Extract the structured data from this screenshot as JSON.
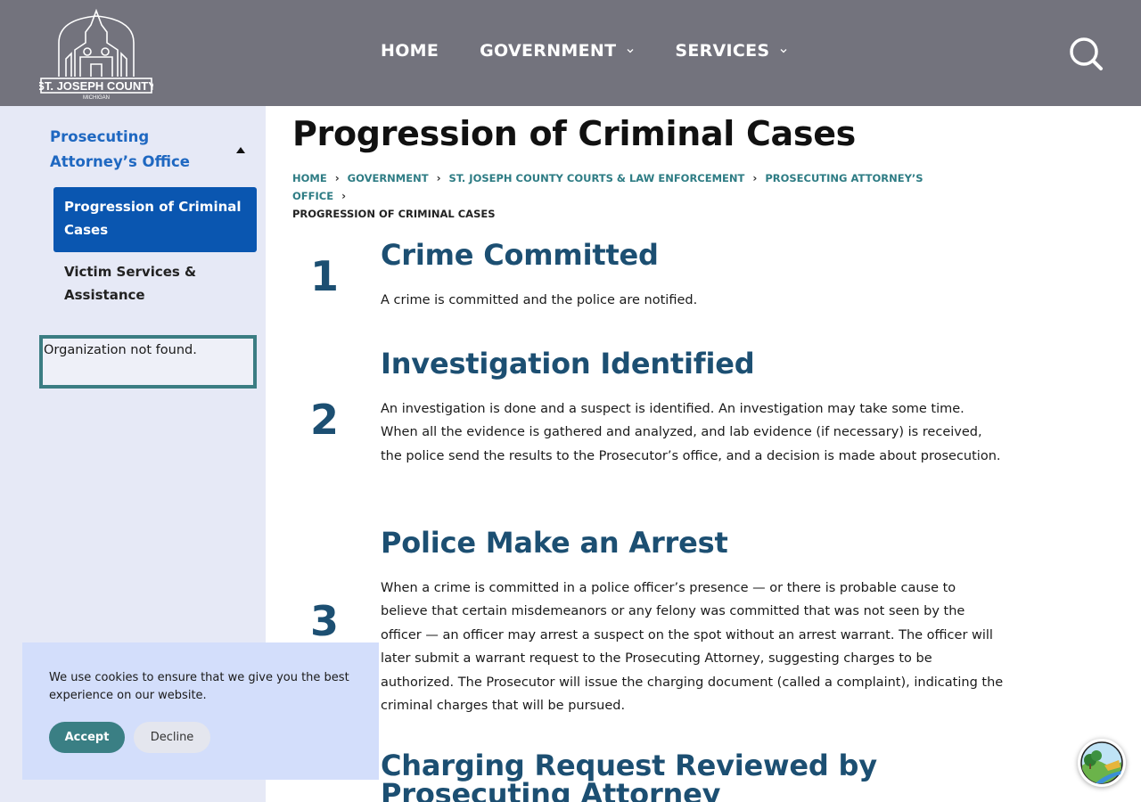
{
  "header": {
    "logo_alt": "ST. JOSEPH COUNTY MICHIGAN",
    "nav": [
      {
        "label": "HOME"
      },
      {
        "label": "GOVERNMENT"
      },
      {
        "label": "SERVICES"
      }
    ],
    "bg_color": "#73737d"
  },
  "sidebar": {
    "parent_label": "Prosecuting Attorney’s Office",
    "active_item": "Progression of Criminal Cases",
    "item": "Victim Services & Assistance",
    "org_message": "Organization not found."
  },
  "main": {
    "title": "Progression of Criminal Cases",
    "breadcrumbs": [
      "HOME",
      "GOVERNMENT",
      "ST. JOSEPH COUNTY COURTS & LAW ENFORCEMENT",
      "PROSECUTING ATTORNEY’S OFFICE",
      "PROGRESSION OF CRIMINAL CASES"
    ],
    "steps": [
      {
        "num": "1",
        "title": "Crime Committed",
        "text": "A crime is committed and the police are notified."
      },
      {
        "num": "2",
        "title": "Investigation Identified",
        "text": "An investigation is done and a suspect is identified. An investigation may take some time. When all the evidence is gathered and analyzed, and lab evidence (if necessary) is received, the police send the results to the Prosecutor’s office, and a decision is made about prosecution."
      },
      {
        "num": "3",
        "title": "Police Make an Arrest",
        "text": "When a crime is committed in a police officer’s presence — or there is probable cause to believe that certain misdemeanors or any felony was committed that was not seen by the officer — an officer may arrest a suspect on the spot without an arrest warrant. The officer will later submit a warrant request to the Prosecuting Attorney, suggesting charges to be authorized. The Prosecutor will issue the charging document (called a complaint), indicating the criminal charges that will be pursued."
      },
      {
        "num": "",
        "title": "Charging Request Reviewed by Prosecuting Attorney",
        "text": ""
      }
    ]
  },
  "cookie": {
    "message": "We use cookies to ensure that we give you the best experience on our website.",
    "accept_label": "Accept",
    "decline_label": "Decline"
  },
  "colors": {
    "accent_blue": "#0a56b0",
    "heading_blue": "#1c4f72",
    "teal": "#3a7f84"
  }
}
